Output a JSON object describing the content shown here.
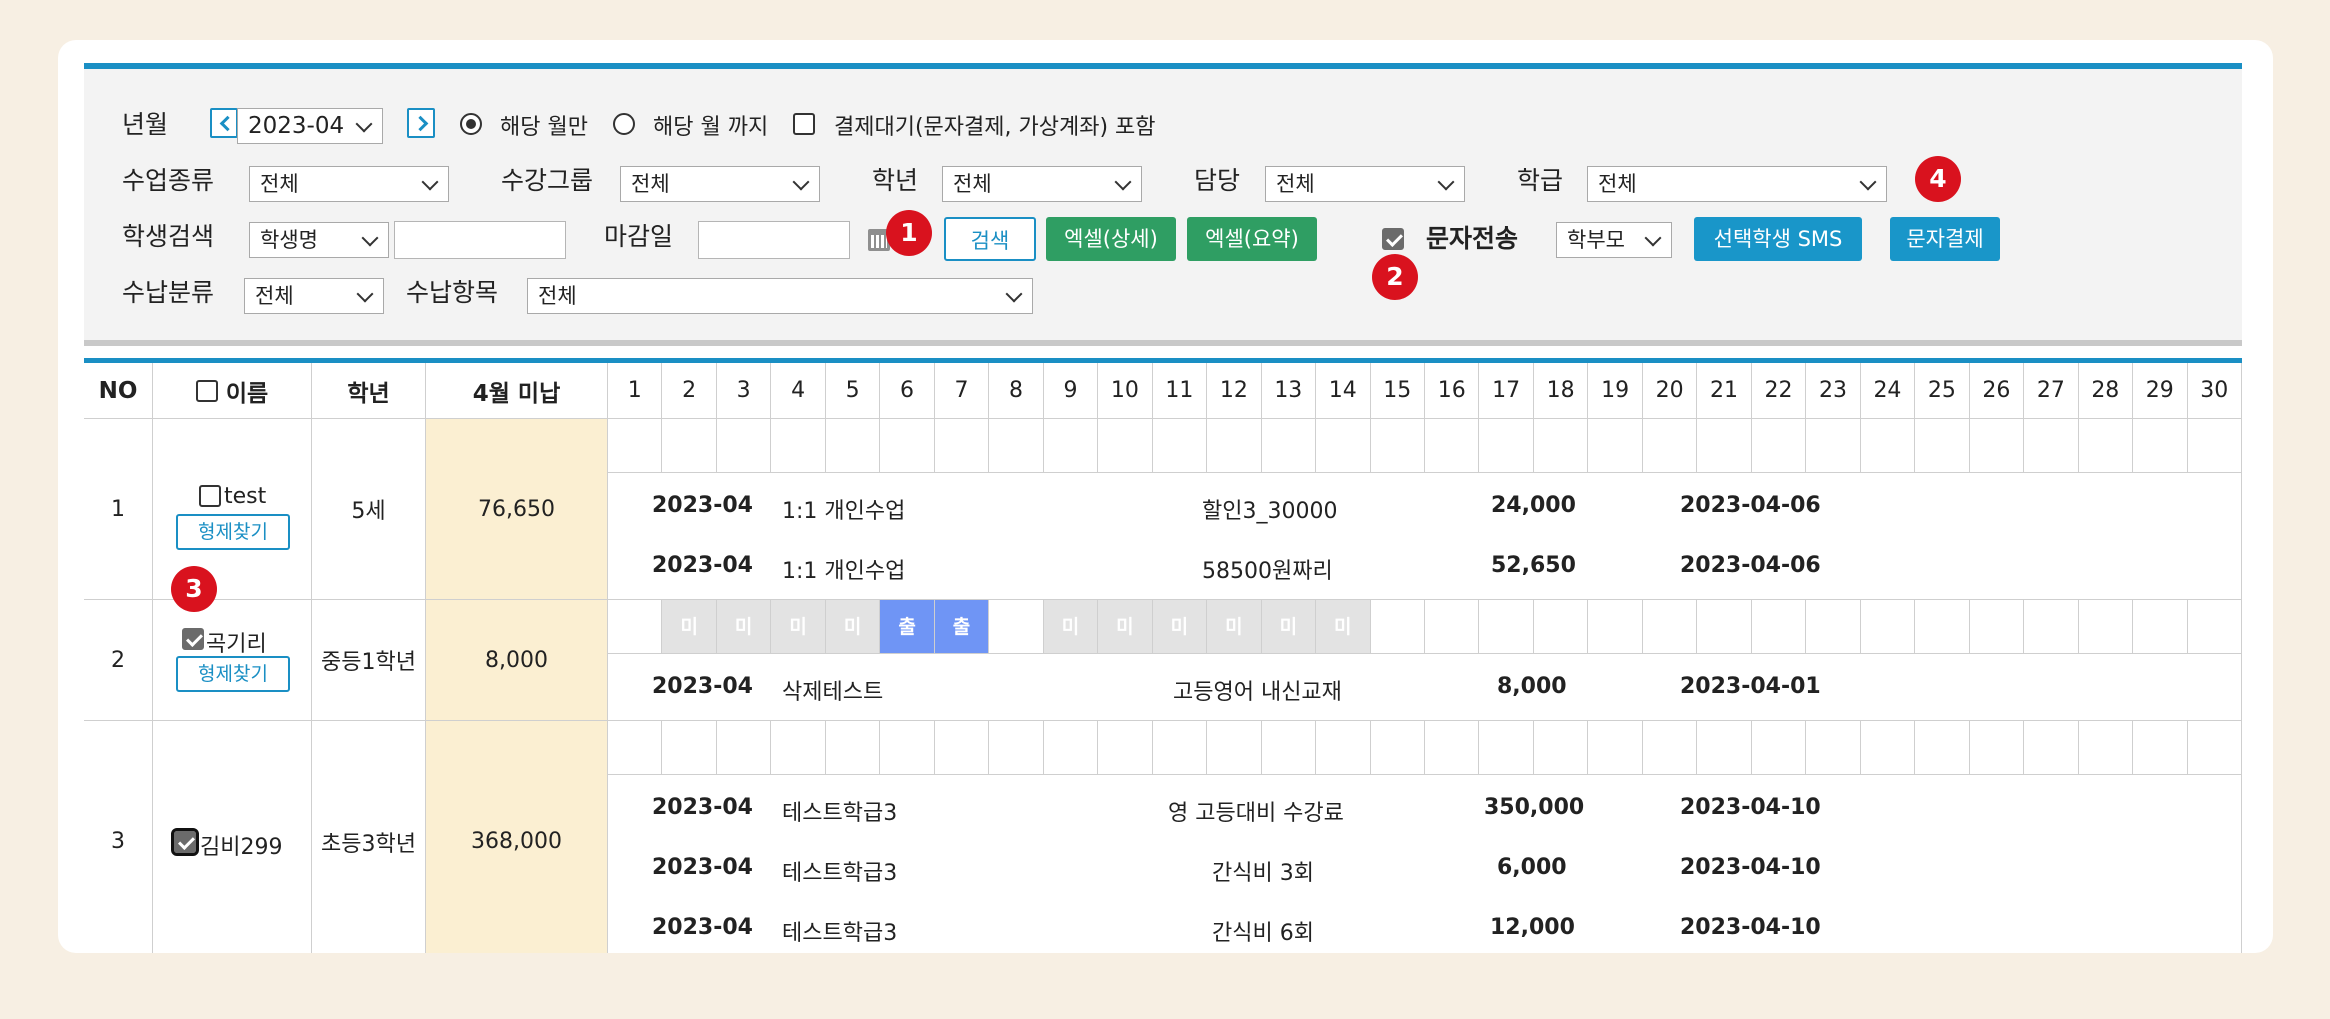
{
  "filters": {
    "yearmonth_label": "년월",
    "yearmonth_value": "2023-04",
    "radio_month_only": "해당 월만",
    "radio_until_month": "해당 월 까지",
    "pending_label": "결제대기(문자결제, 가상계좌) 포함",
    "class_type_label": "수업종류",
    "class_type_value": "전체",
    "course_group_label": "수강그룹",
    "course_group_value": "전체",
    "grade_label": "학년",
    "grade_value": "전체",
    "manager_label": "담당",
    "manager_value": "전체",
    "class_label": "학급",
    "class_value": "전체",
    "student_search_label": "학생검색",
    "student_search_type": "학생명",
    "student_search_value": "",
    "deadline_label": "마감일",
    "deadline_value": "",
    "search_button": "검색",
    "excel_detail_button": "엑셀(상세)",
    "excel_summary_button": "엑셀(요약)",
    "sms_label": "문자전송",
    "sms_target_value": "학부모",
    "selected_sms_button": "선택학생 SMS",
    "sms_payment_button": "문자결제",
    "payment_category_label": "수납분류",
    "payment_category_value": "전체",
    "payment_item_label": "수납항목",
    "payment_item_value": "전체"
  },
  "badges": [
    "1",
    "2",
    "3",
    "4"
  ],
  "table": {
    "headers": {
      "no": "NO",
      "name": "이름",
      "grade": "학년",
      "unpaid": "4월 미납",
      "days": [
        "1",
        "2",
        "3",
        "4",
        "5",
        "6",
        "7",
        "8",
        "9",
        "10",
        "11",
        "12",
        "13",
        "14",
        "15",
        "16",
        "17",
        "18",
        "19",
        "20",
        "21",
        "22",
        "23",
        "24",
        "25",
        "26",
        "27",
        "28",
        "29",
        "30"
      ]
    },
    "sibling_button": "형제찾기",
    "rows": [
      {
        "no": "1",
        "name": "test",
        "grade": "5세",
        "unpaid": "76,650",
        "details": [
          {
            "month": "2023-04",
            "course": "1:1 개인수업",
            "item": "할인3_30000",
            "amount": "24,000",
            "date": "2023-04-06"
          },
          {
            "month": "2023-04",
            "course": "1:1 개인수업",
            "item": "58500원짜리",
            "amount": "52,650",
            "date": "2023-04-06"
          }
        ]
      },
      {
        "no": "2",
        "name": "곡기리",
        "grade": "중등1학년",
        "unpaid": "8,000",
        "attendance": [
          "",
          "미",
          "미",
          "미",
          "미",
          "출",
          "출",
          "",
          "미",
          "미",
          "미",
          "미",
          "미",
          "미",
          "",
          "",
          "",
          "",
          "",
          "",
          "",
          "",
          "",
          "",
          "",
          "",
          "",
          "",
          "",
          ""
        ],
        "details": [
          {
            "month": "2023-04",
            "course": "삭제테스트",
            "item": "고등영어 내신교재",
            "amount": "8,000",
            "date": "2023-04-01"
          }
        ]
      },
      {
        "no": "3",
        "name": "김비299",
        "grade": "초등3학년",
        "unpaid": "368,000",
        "details": [
          {
            "month": "2023-04",
            "course": "테스트학급3",
            "item": "영 고등대비 수강료",
            "amount": "350,000",
            "date": "2023-04-10"
          },
          {
            "month": "2023-04",
            "course": "테스트학급3",
            "item": "간식비 3회",
            "amount": "6,000",
            "date": "2023-04-10"
          },
          {
            "month": "2023-04",
            "course": "테스트학급3",
            "item": "간식비 6회",
            "amount": "12,000",
            "date": "2023-04-10"
          }
        ]
      }
    ]
  }
}
